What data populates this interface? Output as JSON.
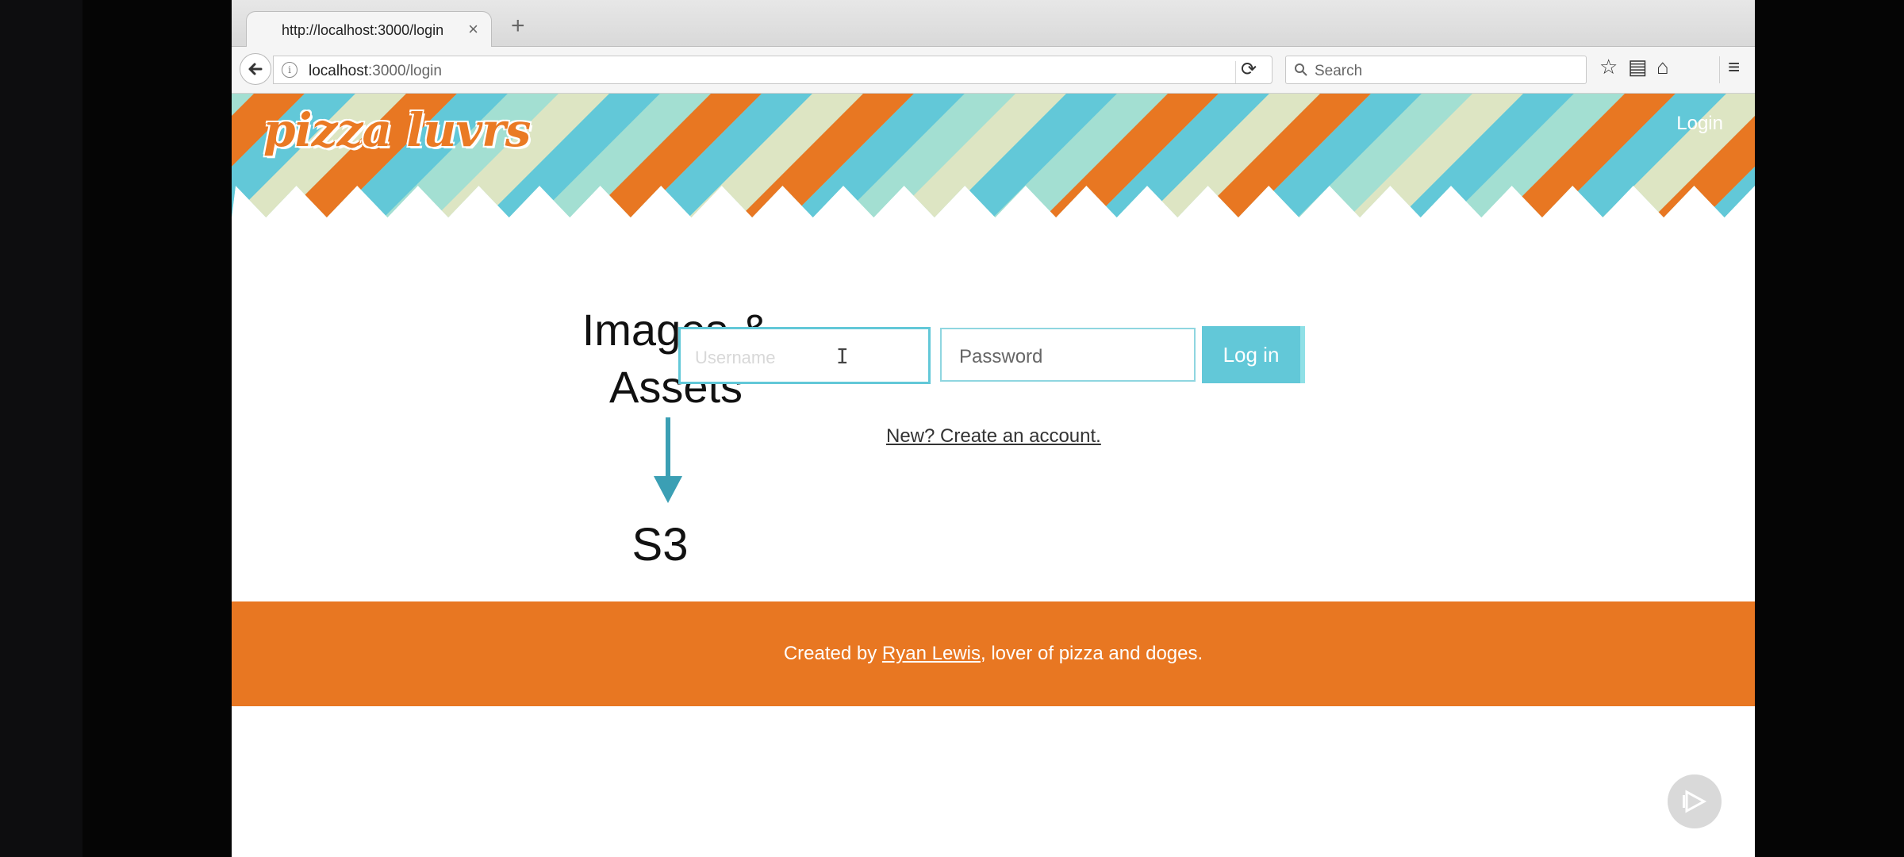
{
  "browser": {
    "tab_title": "http://localhost:3000/login",
    "tab_close": "×",
    "new_tab": "+",
    "url_host": "localhost",
    "url_path": ":3000/login",
    "search_placeholder": "Search"
  },
  "site": {
    "logo": "pizza luvrs",
    "nav_login": "Login"
  },
  "overlay": {
    "title_line1": "Images &",
    "title_line2": "Assets",
    "target": "S3"
  },
  "form": {
    "username_placeholder": "Username",
    "password_placeholder": "Password",
    "submit_label": "Log in",
    "create_account": "New? Create an account."
  },
  "footer": {
    "prefix": "Created by ",
    "author": "Ryan Lewis",
    "suffix": ", lover of pizza and doges."
  },
  "colors": {
    "brand_orange": "#e87722",
    "accent_teal": "#62c8d8",
    "stripe_mint": "#a3dfd2",
    "stripe_cream": "#dde5c3"
  },
  "icons": [
    "back-arrow-icon",
    "info-icon",
    "reload-icon",
    "search-icon",
    "bookmark-star-icon",
    "reading-list-icon",
    "home-icon",
    "menu-icon",
    "text-cursor-icon",
    "arrow-down-icon",
    "play-icon"
  ]
}
